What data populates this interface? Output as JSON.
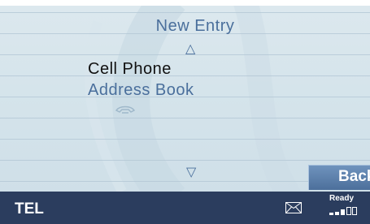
{
  "header": {
    "title": "New Entry"
  },
  "menu": {
    "items": [
      {
        "label": "Cell Phone",
        "selected": true
      },
      {
        "label": "Address Book",
        "selected": false
      }
    ],
    "scroll_up_icon": "triangle-up-outline",
    "scroll_down_icon": "triangle-down-outline"
  },
  "decoration": {
    "icon": "handset-icon"
  },
  "softkey": {
    "back_label": "Back"
  },
  "status_bar": {
    "mode": "TEL",
    "message_icon": "envelope-icon",
    "status": "Ready",
    "signal_icon": "signal-strength-icon"
  },
  "colors": {
    "background": "#d5e4eb",
    "accent_text": "#4a6f9c",
    "selected_text": "#111111",
    "status_bar": "#2b3d5e",
    "button": "#5d81ad"
  }
}
